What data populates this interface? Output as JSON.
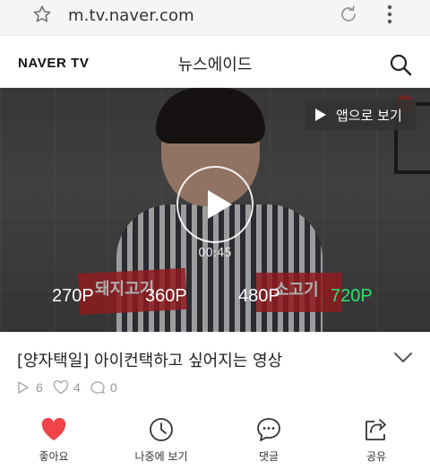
{
  "browser": {
    "url": "m.tv.naver.com"
  },
  "header": {
    "logo": "NAVER TV",
    "title": "뉴스에이드"
  },
  "video": {
    "open_in_app_label": "앱으로 보기",
    "duration": "00:45",
    "quality_options": [
      "270P",
      "360P",
      "480P",
      "720P"
    ],
    "selected_quality": "720P",
    "selected_color": "#2ee06a",
    "sign_left": "돼지고기",
    "sign_right": "소고기"
  },
  "info": {
    "title": "[양자택일] 아이컨택하고 싶어지는 영상",
    "views": "6",
    "likes": "4",
    "comments": "0"
  },
  "actions": [
    {
      "label": "좋아요",
      "icon": "heart-icon",
      "color": "#f0434a"
    },
    {
      "label": "나중에 보기",
      "icon": "clock-icon"
    },
    {
      "label": "댓글",
      "icon": "comment-icon"
    },
    {
      "label": "공유",
      "icon": "share-icon"
    }
  ]
}
